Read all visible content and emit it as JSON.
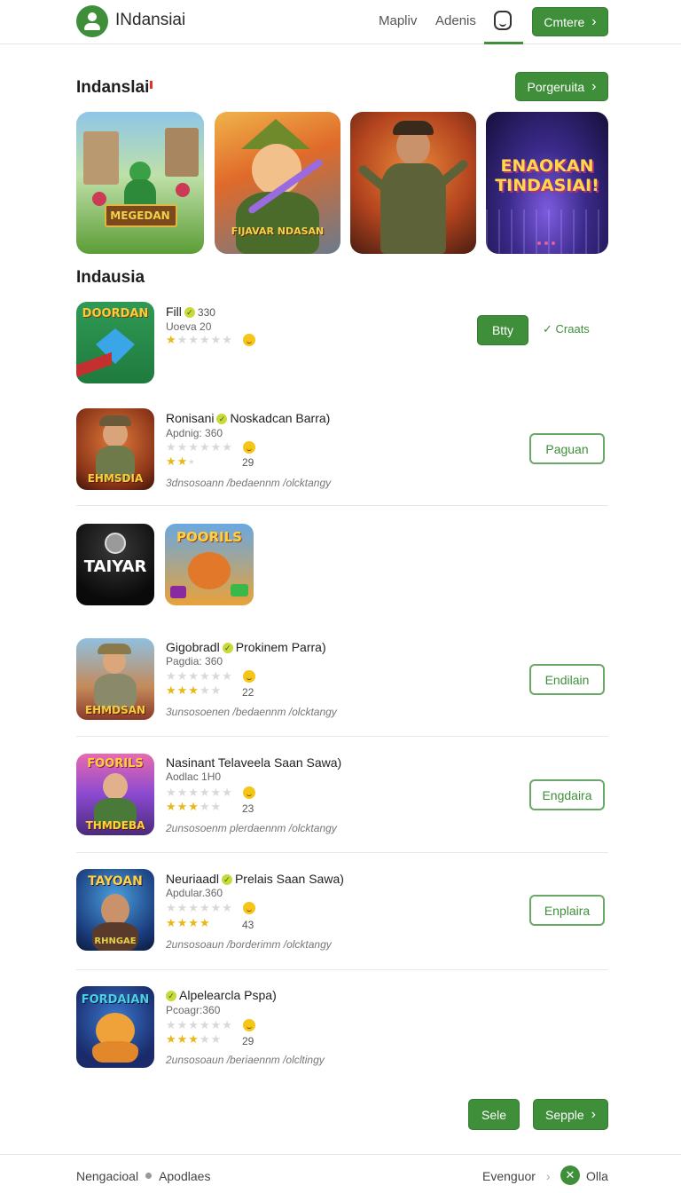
{
  "header": {
    "brand": "INdansiai",
    "nav": [
      "Mapliv",
      "Adenis"
    ],
    "cta_label": "Cmtere"
  },
  "section1": {
    "title": "Indanslai",
    "button_label": "Porgeruita"
  },
  "banners": [
    {
      "text": "MEGEDAN"
    },
    {
      "text": "FIJAVAR NDASAN"
    },
    {
      "text": ""
    },
    {
      "text": "ENAOKAN TINDASIAI!"
    }
  ],
  "section2": {
    "title": "Indausia"
  },
  "items": [
    {
      "thumb_text": "DOORDAN",
      "title_a": "Fill",
      "title_b": "330",
      "sub": "Uoeva 20",
      "stars_on": 1,
      "primary_label": "Btty",
      "secondary_label": "Craats"
    },
    {
      "thumb_text": "EHMSDIA",
      "title_a": "Ronisani",
      "title_b": "Noskadcan Barra)",
      "sub": "Apdnig: 360",
      "stars_on": 2,
      "count": "29",
      "desc": "3dnsosoann /bedaennm /olcktangy",
      "button_label": "Paguan"
    },
    {
      "thumb_text": "TAIYAR",
      "thumb2_text": "POORILS"
    },
    {
      "thumb_text": "EHMDSAN",
      "title_a": "Gigobradl",
      "title_b": "Prokinem Parra)",
      "sub": "Pagdia: 360",
      "stars_on": 3,
      "count": "22",
      "desc": "3unsosoenen /bedaennm /olcktangy",
      "button_label": "Endilain"
    },
    {
      "thumb_text": "FOORILS",
      "thumb_text_b": "THMDEBA",
      "title_a": "Nasinant Telaveela",
      "title_b": "Saan Sawa)",
      "sub": "Aodlac 1H0",
      "stars_on": 3,
      "count": "23",
      "desc": "2unsosoenm plerdaennm /olcktangy",
      "button_label": "Engdaira"
    },
    {
      "thumb_text": "TAYOAN",
      "thumb_text_b": "RHNGAE",
      "title_a": "Neuriaadl",
      "title_b": "Prelais Saan Sawa)",
      "sub": "Apdular.360",
      "stars_on": 4,
      "count": "43",
      "desc": "2unsosoaun /borderimm /olcktangy",
      "button_label": "Enplaira"
    },
    {
      "thumb_text": "FORDAIAN",
      "title_a": "Alpelearcla",
      "title_b": "Pspa)",
      "sub": "Pcoagr:360",
      "stars_on": 3,
      "count": "29",
      "desc": "2unsosoaun /beriaennm /olcltingy"
    }
  ],
  "pagination": {
    "left_label": "Sele",
    "right_label": "Sepple"
  },
  "footer": {
    "left_a": "Nengacioal",
    "left_b": "Apodlaes",
    "right_a": "Evenguor",
    "right_b": "Olla"
  },
  "colors": {
    "accent": "#3f8f3a",
    "star": "#e8b818"
  }
}
